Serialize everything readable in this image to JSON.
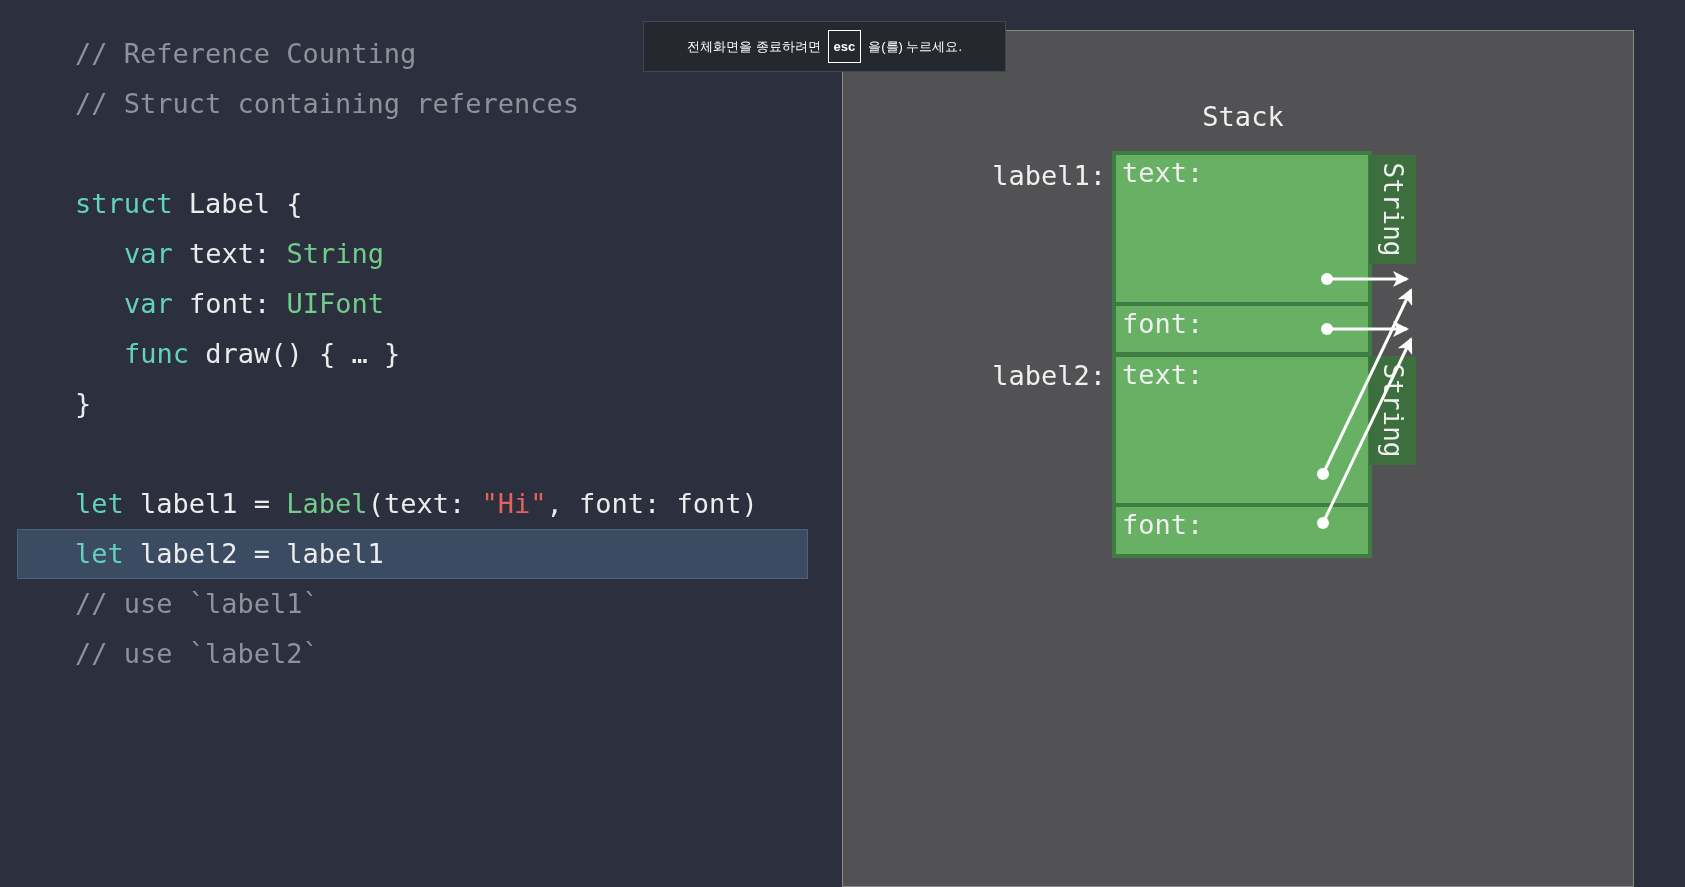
{
  "code": {
    "blocks": [
      {
        "lines": [
          {
            "selected": false,
            "indented": false,
            "tokens": [
              {
                "kind": "comment",
                "text": "// Reference Counting"
              }
            ]
          },
          {
            "selected": false,
            "indented": false,
            "tokens": [
              {
                "kind": "comment",
                "text": "// Struct containing references"
              }
            ]
          }
        ]
      },
      {
        "lines": [
          {
            "selected": false,
            "indented": false,
            "tokens": [
              {
                "kind": "keyword",
                "text": "struct"
              },
              {
                "kind": "plain",
                "text": " Label {"
              }
            ]
          },
          {
            "selected": false,
            "indented": true,
            "tokens": [
              {
                "kind": "keyword",
                "text": "var"
              },
              {
                "kind": "plain",
                "text": " text: "
              },
              {
                "kind": "type",
                "text": "String"
              }
            ]
          },
          {
            "selected": false,
            "indented": true,
            "tokens": [
              {
                "kind": "keyword",
                "text": "var"
              },
              {
                "kind": "plain",
                "text": " font: "
              },
              {
                "kind": "type",
                "text": "UIFont"
              }
            ]
          },
          {
            "selected": false,
            "indented": true,
            "tokens": [
              {
                "kind": "keyword",
                "text": "func"
              },
              {
                "kind": "plain",
                "text": " draw() { … }"
              }
            ]
          },
          {
            "selected": false,
            "indented": false,
            "tokens": [
              {
                "kind": "plain",
                "text": "}"
              }
            ]
          }
        ]
      },
      {
        "lines": [
          {
            "selected": false,
            "indented": false,
            "tokens": [
              {
                "kind": "keyword",
                "text": "let"
              },
              {
                "kind": "plain",
                "text": " label1 = "
              },
              {
                "kind": "type",
                "text": "Label"
              },
              {
                "kind": "plain",
                "text": "(text: "
              },
              {
                "kind": "string",
                "text": "\"Hi\""
              },
              {
                "kind": "plain",
                "text": ", font: font)"
              }
            ]
          },
          {
            "selected": true,
            "indented": false,
            "tokens": [
              {
                "kind": "keyword",
                "text": "let"
              },
              {
                "kind": "plain",
                "text": " label2 = label1"
              }
            ]
          },
          {
            "selected": false,
            "indented": false,
            "tokens": [
              {
                "kind": "comment",
                "text": "// use `label1`"
              }
            ]
          },
          {
            "selected": false,
            "indented": false,
            "tokens": [
              {
                "kind": "comment",
                "text": "// use `label2`"
              }
            ]
          }
        ]
      }
    ]
  },
  "toast": {
    "before": "전체화면을 종료하려면",
    "key": "esc",
    "after": "을(를) 누르세요."
  },
  "diagram": {
    "title": "Stack",
    "variables": [
      {
        "name": "label1:",
        "fields": [
          "text:",
          "font:"
        ]
      },
      {
        "name": "label2:",
        "fields": [
          "text:",
          "font:"
        ]
      }
    ],
    "heap_tags": [
      "String",
      "String"
    ]
  }
}
